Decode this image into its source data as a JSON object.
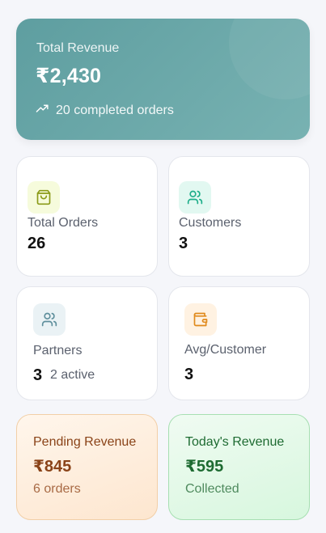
{
  "revenue": {
    "label": "Total Revenue",
    "amount": "₹2,430",
    "subtitle": "20 completed orders",
    "icon": "trending-up-icon"
  },
  "stats": {
    "total_orders": {
      "label": "Total Orders",
      "value": "26",
      "icon": "shopping-bag-icon",
      "icon_color": "#8a9a18",
      "icon_bg": "#f6fbdc"
    },
    "customers": {
      "label": "Customers",
      "value": "3",
      "icon": "users-icon",
      "icon_color": "#1eae8a",
      "icon_bg": "#e2f8f1"
    },
    "partners": {
      "label": "Partners",
      "value": "3",
      "extra": "2 active",
      "icon": "users-icon",
      "icon_color": "#5e8f9c",
      "icon_bg": "#eaf2f5"
    },
    "avg_customer": {
      "label": "Avg/Customer",
      "value": "3",
      "icon": "wallet-icon",
      "icon_color": "#e08a1c",
      "icon_bg": "#fff2e2"
    }
  },
  "pending": {
    "label": "Pending Revenue",
    "amount": "₹845",
    "sub": "6 orders",
    "color": "#8a4318",
    "sub_color": "#a86a45"
  },
  "today": {
    "label": "Today's Revenue",
    "amount": "₹595",
    "sub": "Collected",
    "color": "#1e6b32",
    "sub_color": "#4f8a5e"
  }
}
